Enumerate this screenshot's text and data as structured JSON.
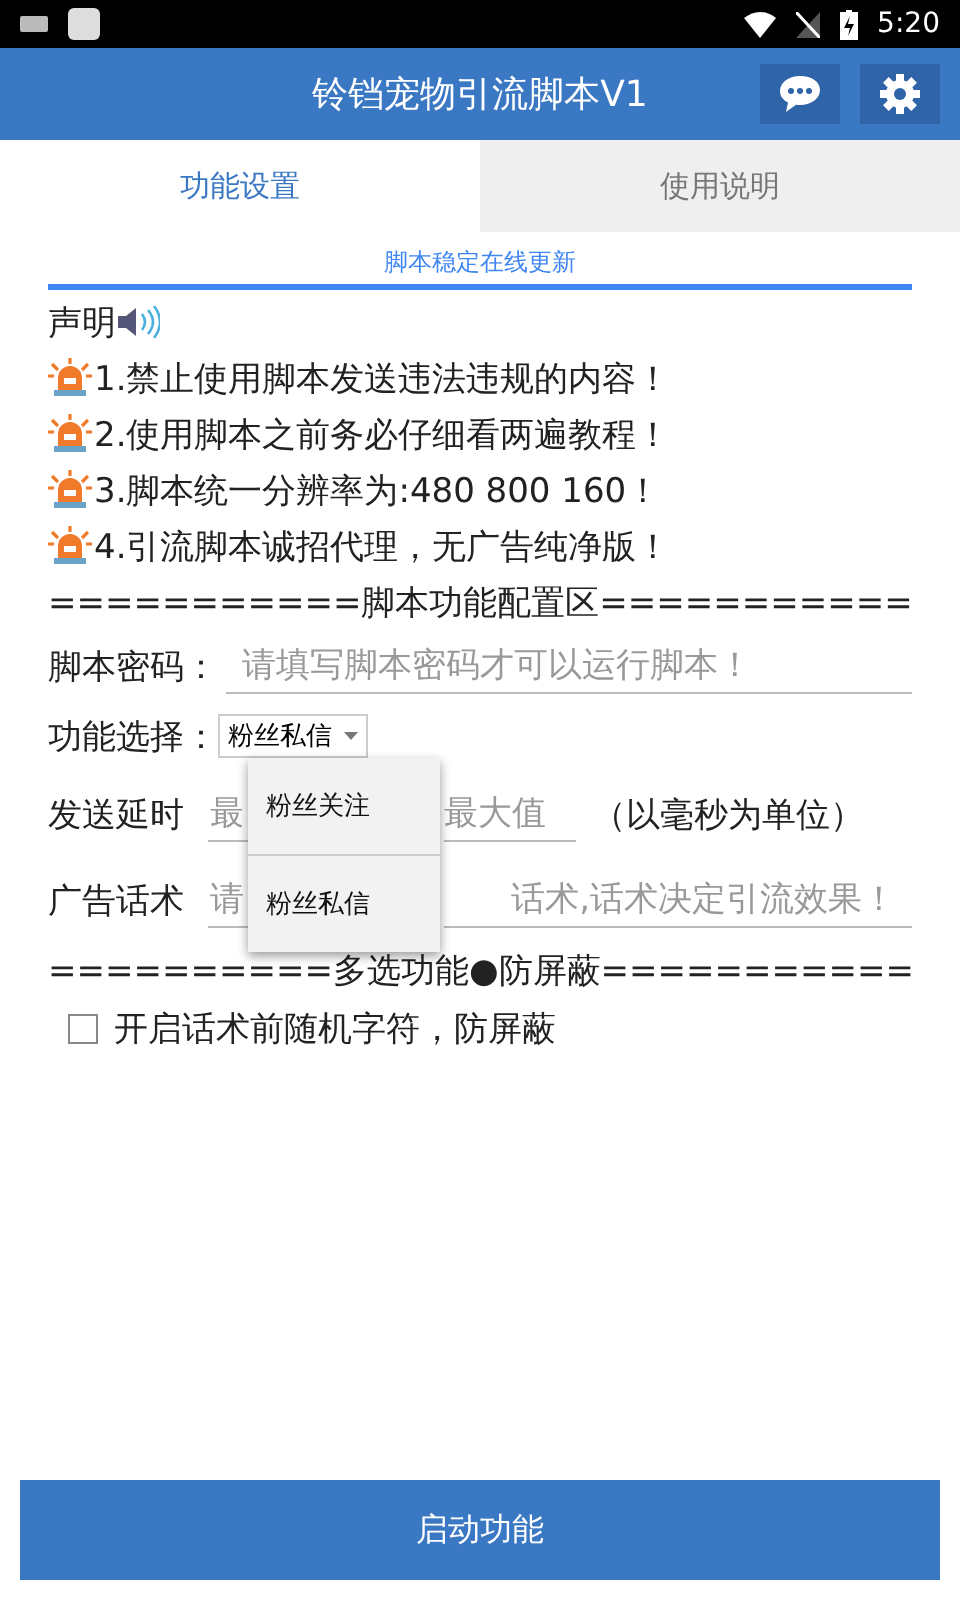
{
  "status_bar": {
    "time": "5:20"
  },
  "app_bar": {
    "title": "铃铛宠物引流脚本V1"
  },
  "tabs": [
    {
      "label": "功能设置",
      "selected": true
    },
    {
      "label": "使用说明",
      "selected": false
    }
  ],
  "notice": "脚本稳定在线更新",
  "statement": {
    "title": "声明",
    "items": [
      "1.禁止使用脚本发送违法违规的内容！",
      "2.使用脚本之前务必仔细看两遍教程！",
      "3.脚本统一分辨率为:480  800  160！",
      "4.引流脚本诚招代理，无广告纯净版！"
    ]
  },
  "config_divider": "===========脚本功能配置区===========",
  "password": {
    "label": "脚本密码：",
    "placeholder": "请填写脚本密码才可以运行脚本！"
  },
  "function_select": {
    "label": "功能选择：",
    "value": "粉丝私信",
    "open": true,
    "options": [
      "粉丝关注",
      "粉丝私信"
    ]
  },
  "delay": {
    "label": "发送延时",
    "min_placeholder": "最",
    "max_placeholder": "最大值",
    "unit": "（以毫秒为单位）"
  },
  "ad_text": {
    "label": "广告话术",
    "placeholder_start": "请",
    "placeholder_end": "话术,话术决定引流效果！"
  },
  "multi_divider": "==========多选功能●防屏蔽===========",
  "random_chars": {
    "label": "开启话术前随机字符，防屏蔽",
    "checked": false
  },
  "start_button": "启动功能"
}
